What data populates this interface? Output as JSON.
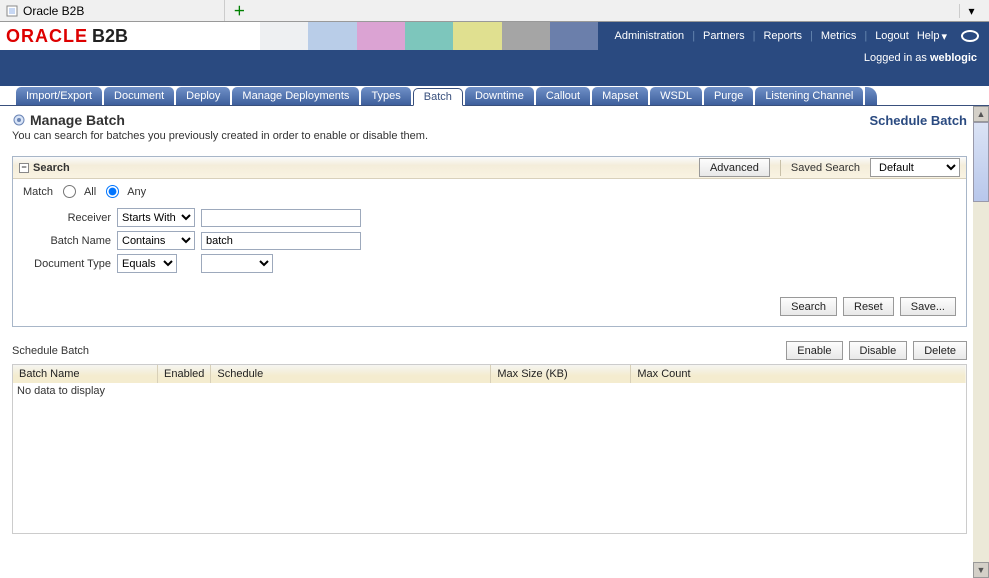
{
  "window": {
    "title": "Oracle B2B"
  },
  "brand": {
    "vendor": "ORACLE",
    "product": "B2B"
  },
  "topnav": {
    "items": [
      "Administration",
      "Partners",
      "Reports",
      "Metrics",
      "Logout"
    ],
    "help": "Help"
  },
  "status": {
    "logged_in_as": "Logged in as ",
    "user": "weblogic"
  },
  "tabs": [
    "Import/Export",
    "Document",
    "Deploy",
    "Manage Deployments",
    "Types",
    "Batch",
    "Downtime",
    "Callout",
    "Mapset",
    "WSDL",
    "Purge",
    "Listening Channel"
  ],
  "active_tab_index": 5,
  "page": {
    "title": "Manage Batch",
    "description": "You can search for batches you previously created in order to enable or disable them.",
    "action_link": "Schedule Batch"
  },
  "search_panel": {
    "title": "Search",
    "advanced": "Advanced",
    "saved_search_label": "Saved Search",
    "saved_search_value": "Default",
    "match": {
      "label": "Match",
      "all": "All",
      "any": "Any",
      "selected": "any"
    },
    "criteria": {
      "receiver": {
        "label": "Receiver",
        "operator": "Starts With",
        "value": ""
      },
      "batch_name": {
        "label": "Batch Name",
        "operator": "Contains",
        "value": "batch"
      },
      "document_type": {
        "label": "Document Type",
        "operator": "Equals",
        "value": ""
      }
    },
    "actions": {
      "search": "Search",
      "reset": "Reset",
      "save": "Save..."
    }
  },
  "section": {
    "title": "Schedule Batch",
    "actions": {
      "enable": "Enable",
      "disable": "Disable",
      "delete": "Delete"
    }
  },
  "table": {
    "columns": [
      "Batch Name",
      "Enabled",
      "Schedule",
      "Max Size (KB)",
      "Max Count"
    ],
    "empty": "No data to display"
  }
}
